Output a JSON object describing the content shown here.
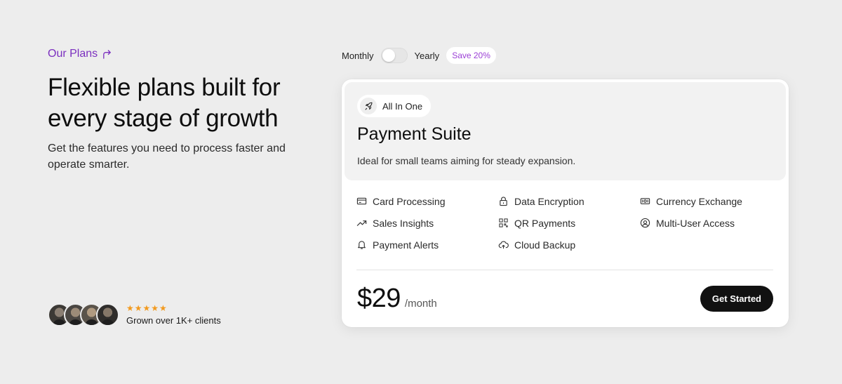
{
  "left": {
    "eyebrow": "Our Plans",
    "headline": "Flexible plans built for every stage of growth",
    "subtext": "Get the features you need to process faster and operate smarter.",
    "social": {
      "stars": "★★★★★",
      "text": "Grown over 1K+ clients"
    }
  },
  "billing": {
    "monthly": "Monthly",
    "yearly": "Yearly",
    "save_badge": "Save 20%",
    "yearly_selected": false
  },
  "card": {
    "tag": "All In One",
    "plan_name": "Payment Suite",
    "description": "Ideal for small teams aiming for steady expansion.",
    "features": [
      {
        "label": "Card Processing",
        "icon": "credit-card-icon"
      },
      {
        "label": "Data Encryption",
        "icon": "lock-icon"
      },
      {
        "label": "Currency Exchange",
        "icon": "banknote-icon"
      },
      {
        "label": "Sales Insights",
        "icon": "trending-up-icon"
      },
      {
        "label": "QR Payments",
        "icon": "qr-code-icon"
      },
      {
        "label": "Multi-User Access",
        "icon": "user-circle-icon"
      },
      {
        "label": "Payment Alerts",
        "icon": "bell-icon"
      },
      {
        "label": "Cloud Backup",
        "icon": "cloud-upload-icon"
      }
    ],
    "price": "$29",
    "period": "/month",
    "cta": "Get Started"
  },
  "colors": {
    "accent": "#7b2fbf",
    "badge_text": "#9b3fd6",
    "stars": "#f29a1f",
    "cta_bg": "#111111",
    "page_bg": "#ededed"
  }
}
